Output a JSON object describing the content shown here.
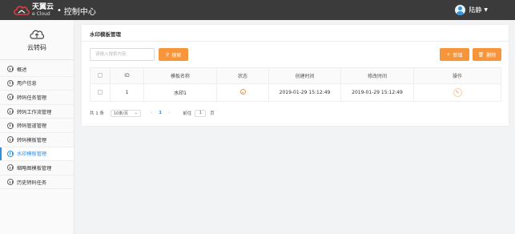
{
  "header": {
    "logo_main": "天翼云",
    "logo_sub": "e Cloud",
    "separator": "•",
    "title": "控制中心",
    "user_name": "陆静"
  },
  "sidebar": {
    "title": "云转码",
    "items": [
      {
        "label": "概述",
        "active": false
      },
      {
        "label": "用户信息",
        "active": false
      },
      {
        "label": "转码任务管理",
        "active": false
      },
      {
        "label": "转码工作流管理",
        "active": false
      },
      {
        "label": "转码管道管理",
        "active": false
      },
      {
        "label": "转码模板管理",
        "active": false
      },
      {
        "label": "水印模板管理",
        "active": true
      },
      {
        "label": "缩略图模板管理",
        "active": false
      },
      {
        "label": "历史转码任务",
        "active": false
      }
    ]
  },
  "main": {
    "card_title": "水印模板管理",
    "search_placeholder": "请输入搜索内容",
    "search_button": "搜索",
    "add_button": "新增",
    "delete_button": "删除",
    "table": {
      "headers": [
        "ID",
        "模板名称",
        "状态",
        "创建时间",
        "修改时间",
        "操作"
      ],
      "rows": [
        {
          "id": "1",
          "name": "水印1",
          "created": "2019-01-29 15:12:49",
          "modified": "2019-01-29 15:12:49"
        }
      ]
    },
    "pagination": {
      "total": "共 1 条",
      "page_size": "10条/页",
      "current_page": "1",
      "goto_label": "前往",
      "goto_value": "1",
      "page_unit": "页"
    }
  },
  "colors": {
    "accent": "#f7953a",
    "active": "#2f8fe6",
    "topbar": "#3b3b3b"
  }
}
